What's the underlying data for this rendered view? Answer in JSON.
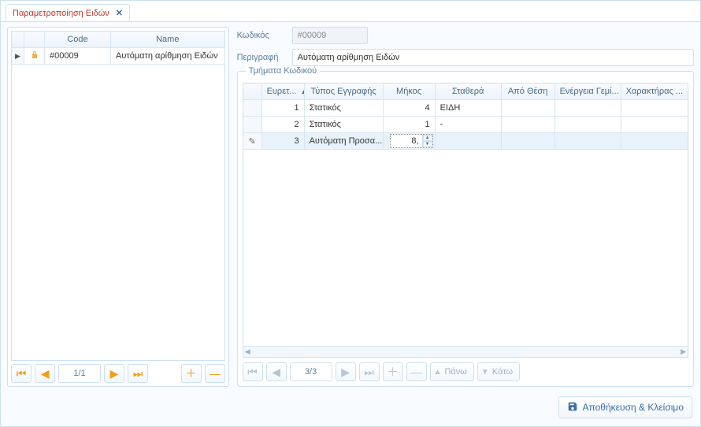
{
  "tab": {
    "label": "Παραμετροποίηση Ειδών"
  },
  "left_grid": {
    "header_code": "Code",
    "header_name": "Name",
    "rows": [
      {
        "code": "#00009",
        "name": "Αυτόματη αρίθμηση Ειδών"
      }
    ]
  },
  "left_nav": {
    "page": "1/1"
  },
  "form": {
    "code_label": "Κωδικός",
    "code_value": "#00009",
    "desc_label": "Περιγραφή",
    "desc_value": "Αυτόματη αρίθμηση Ειδών"
  },
  "group_caption": "Τμήματα Κωδικού",
  "right_grid": {
    "headers": {
      "index": "Ευρετ...",
      "type": "Τύπος Εγγραφής",
      "length": "Μήκος",
      "constant": "Σταθερά",
      "fromPos": "Από Θέση",
      "fill": "Ενέργεια Γεμί...",
      "char": "Χαρακτήρας ..."
    },
    "rows": [
      {
        "idx": "1",
        "type": "Στατικός",
        "len": "4",
        "constv": "ΕΙΔΗ",
        "pos": "",
        "fill": "",
        "chr": ""
      },
      {
        "idx": "2",
        "type": "Στατικός",
        "len": "1",
        "constv": "-",
        "pos": "",
        "fill": "",
        "chr": ""
      },
      {
        "idx": "3",
        "type": "Αυτόματη Προσα...",
        "len": "8,",
        "constv": "",
        "pos": "",
        "fill": "",
        "chr": ""
      }
    ]
  },
  "right_nav": {
    "page": "3/3",
    "up_label": "Πάνω",
    "down_label": "Κάτω"
  },
  "footer": {
    "save_label": "Αποθήκευση & Κλείσιμο"
  }
}
